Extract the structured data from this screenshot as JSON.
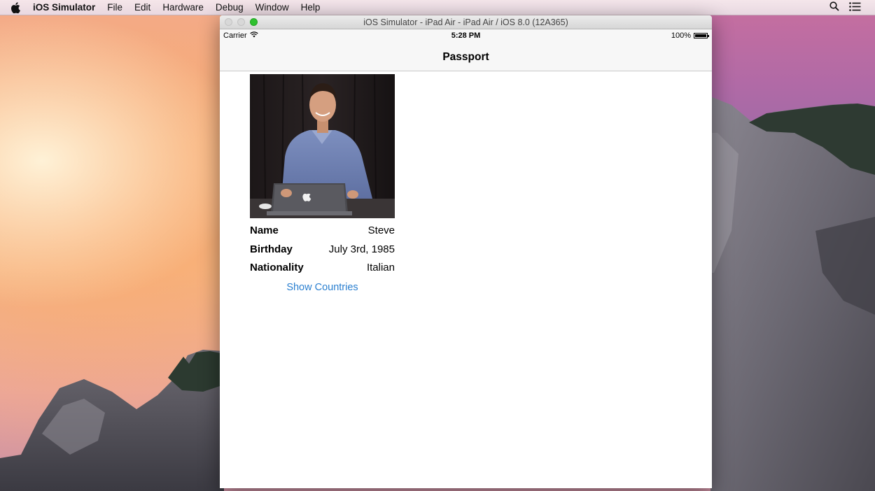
{
  "menubar": {
    "app_name": "iOS Simulator",
    "items": [
      "File",
      "Edit",
      "Hardware",
      "Debug",
      "Window",
      "Help"
    ]
  },
  "window": {
    "title": "iOS Simulator - iPad Air - iPad Air / iOS 8.0 (12A365)"
  },
  "statusbar": {
    "carrier": "Carrier",
    "time": "5:28 PM",
    "battery": "100%"
  },
  "navbar": {
    "title": "Passport"
  },
  "profile": {
    "fields": [
      {
        "label": "Name",
        "value": "Steve"
      },
      {
        "label": "Birthday",
        "value": "July 3rd, 1985"
      },
      {
        "label": "Nationality",
        "value": "Italian"
      }
    ],
    "show_countries_label": "Show Countries"
  },
  "colors": {
    "link": "#2a7fd0",
    "zoom_button": "#2fc12f"
  }
}
